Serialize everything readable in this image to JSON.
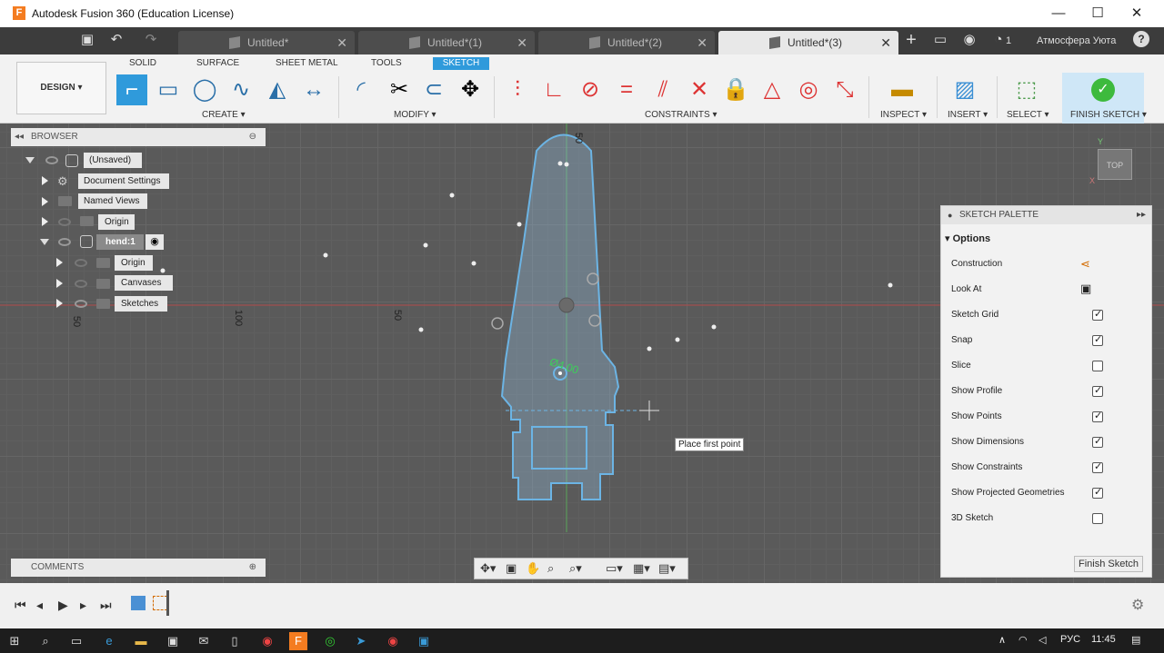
{
  "app": {
    "title": "Autodesk Fusion 360 (Education License)",
    "icon_letter": "F"
  },
  "window": {
    "minimize": "—",
    "maximize": "☐",
    "close": "✕"
  },
  "tabs": [
    {
      "label": "Untitled*",
      "close": "✕"
    },
    {
      "label": "Untitled*(1)",
      "close": "✕"
    },
    {
      "label": "Untitled*(2)",
      "close": "✕"
    },
    {
      "label": "Untitled*(3)",
      "close": "✕"
    }
  ],
  "user": {
    "job_count": "1",
    "name": "Атмосфера Уюта",
    "help": "?"
  },
  "toolbar": {
    "workspace": "DESIGN ▾",
    "ribbon_tabs": [
      "SOLID",
      "SURFACE",
      "SHEET METAL",
      "TOOLS",
      "SKETCH"
    ],
    "groups": {
      "create": "CREATE ▾",
      "modify": "MODIFY ▾",
      "constraints": "CONSTRAINTS ▾",
      "inspect": "INSPECT ▾",
      "insert": "INSERT ▾",
      "select": "SELECT ▾",
      "finish": "FINISH SKETCH ▾"
    }
  },
  "browser": {
    "title": "BROWSER",
    "items": [
      {
        "label": "(Unsaved)"
      },
      {
        "label": "Document Settings"
      },
      {
        "label": "Named Views"
      },
      {
        "label": "Origin"
      },
      {
        "label": "hend:1"
      },
      {
        "label": "Origin"
      },
      {
        "label": "Canvases"
      },
      {
        "label": "Sketches"
      }
    ]
  },
  "comments": {
    "title": "COMMENTS"
  },
  "canvas": {
    "ruler_labels": [
      "50",
      "100",
      "50",
      "50"
    ],
    "dimension_label": "Ø4.00",
    "tooltip": "Place first point",
    "viewcube_label": "TOP",
    "axis_y": "Y",
    "axis_x": "X"
  },
  "palette": {
    "title": "SKETCH PALETTE",
    "section": "Options",
    "options": [
      {
        "label": "Construction",
        "type": "icon"
      },
      {
        "label": "Look At",
        "type": "icon"
      },
      {
        "label": "Sketch Grid",
        "checked": true
      },
      {
        "label": "Snap",
        "checked": true
      },
      {
        "label": "Slice",
        "checked": false
      },
      {
        "label": "Show Profile",
        "checked": true
      },
      {
        "label": "Show Points",
        "checked": true
      },
      {
        "label": "Show Dimensions",
        "checked": true
      },
      {
        "label": "Show Constraints",
        "checked": true
      },
      {
        "label": "Show Projected Geometries",
        "checked": true
      },
      {
        "label": "3D Sketch",
        "checked": false
      }
    ],
    "finish_button": "Finish Sketch"
  },
  "taskbar": {
    "lang": "РУС",
    "time": "11:45"
  },
  "colors": {
    "accent": "#2f9adb",
    "sketch_line": "#6cb4e4",
    "finish_green": "#3dba3d"
  }
}
